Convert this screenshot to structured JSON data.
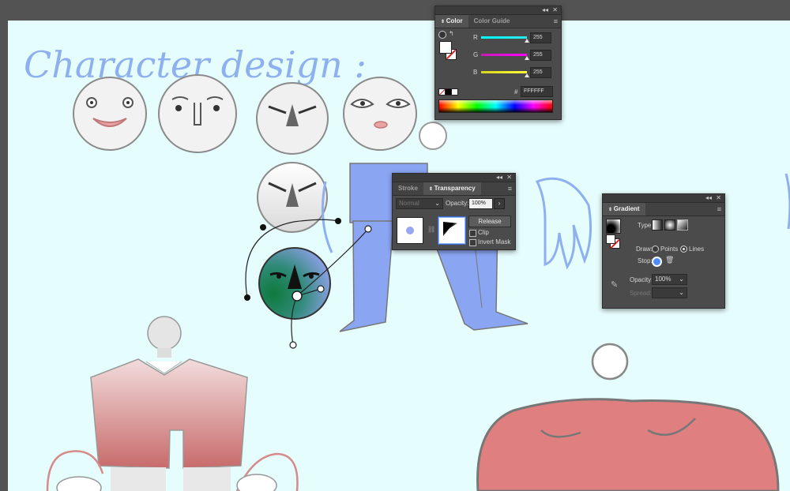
{
  "canvas": {
    "background": "#e6fdfd",
    "outer_background": "#535353",
    "title_text": "Character design :"
  },
  "color_panel": {
    "tabs": [
      "Color",
      "Color Guide"
    ],
    "active_tab": "Color",
    "channels": [
      {
        "label": "R",
        "value": "255",
        "color": "#23e0e6"
      },
      {
        "label": "G",
        "value": "255",
        "color": "#d11fbf"
      },
      {
        "label": "B",
        "value": "255",
        "color": "#e2e21c"
      }
    ],
    "hex_label": "#",
    "hex_value": "FFFFFF"
  },
  "transparency_panel": {
    "tabs": [
      "Stroke",
      "Transparency"
    ],
    "active_tab": "Transparency",
    "blend_mode": "Normal",
    "opacity_label": "Opacity:",
    "opacity_value": "100%",
    "release_label": "Release",
    "clip_label": "Clip",
    "invert_mask_label": "Invert Mask"
  },
  "gradient_panel": {
    "tab": "Gradient",
    "type_label": "Type:",
    "draw_label": "Draw:",
    "points_label": "Points",
    "lines_label": "Lines",
    "draw_selected": "Lines",
    "stop_label": "Stop:",
    "opacity_label": "Opacity:",
    "opacity_value": "100%",
    "spread_label": "Spread:"
  }
}
